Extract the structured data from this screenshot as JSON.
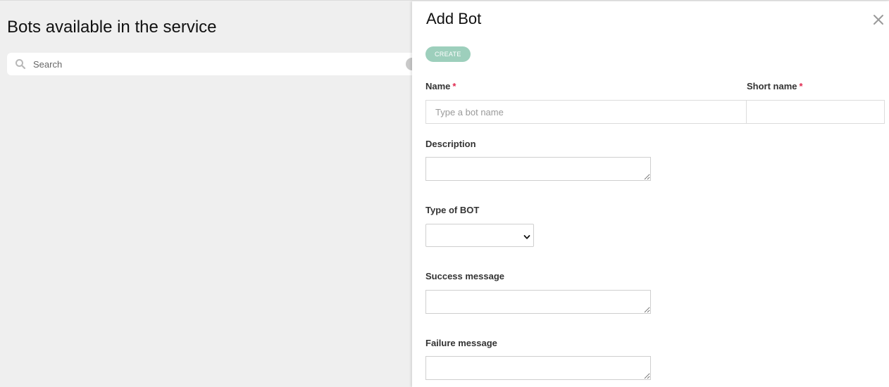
{
  "page": {
    "title": "Bots available in the service",
    "search": {
      "placeholder": "Search",
      "value": ""
    }
  },
  "drawer": {
    "title": "Add Bot",
    "create_label": "CREATE",
    "close_icon": "close-icon",
    "fields": {
      "name": {
        "label": "Name",
        "required_mark": "*",
        "placeholder": "Type a bot name",
        "value": ""
      },
      "short_name": {
        "label": "Short name",
        "required_mark": "*",
        "value": ""
      },
      "description": {
        "label": "Description",
        "value": ""
      },
      "type": {
        "label": "Type of BOT",
        "selected": ""
      },
      "success_message": {
        "label": "Success message",
        "value": ""
      },
      "failure_message": {
        "label": "Failure message",
        "value": ""
      }
    }
  },
  "colors": {
    "background": "#efefef",
    "create_button": "#9dcfbc",
    "required_asterisk": "#e0284f"
  }
}
